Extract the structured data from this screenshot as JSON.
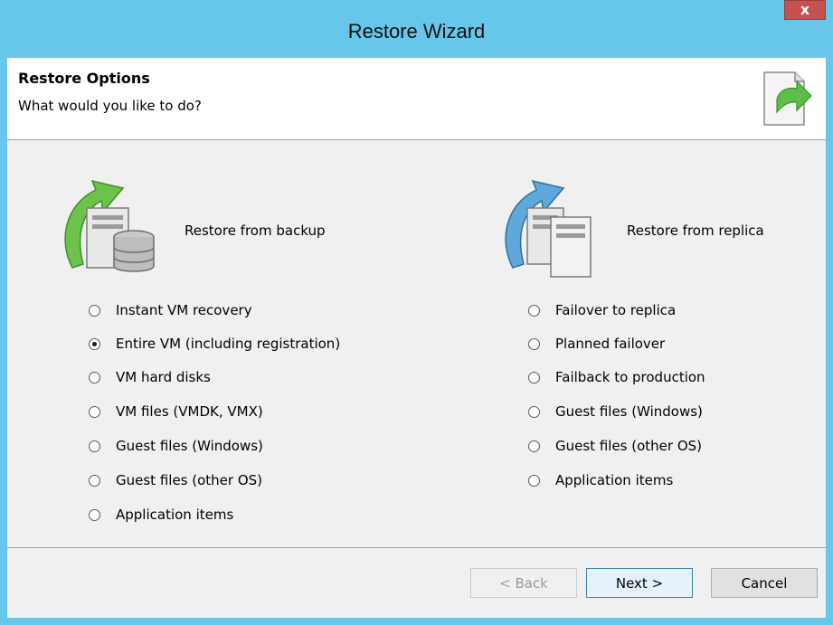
{
  "window": {
    "title": "Restore Wizard",
    "close_symbol": "x"
  },
  "header": {
    "title": "Restore Options",
    "subtitle": "What would you like to do?",
    "icon": "restore-wizard-icon"
  },
  "backup": {
    "label": "Restore from backup",
    "icon": "server-with-database-green-arrow-icon",
    "options": [
      {
        "label": "Instant VM recovery",
        "checked": false
      },
      {
        "label": "Entire VM (including registration)",
        "checked": true
      },
      {
        "label": "VM hard disks",
        "checked": false
      },
      {
        "label": "VM files (VMDK, VMX)",
        "checked": false
      },
      {
        "label": "Guest files (Windows)",
        "checked": false
      },
      {
        "label": "Guest files (other OS)",
        "checked": false
      },
      {
        "label": "Application items",
        "checked": false
      }
    ]
  },
  "replica": {
    "label": "Restore from replica",
    "icon": "two-servers-blue-arrow-icon",
    "options": [
      {
        "label": "Failover to replica",
        "checked": false
      },
      {
        "label": "Planned failover",
        "checked": false
      },
      {
        "label": "Failback to production",
        "checked": false
      },
      {
        "label": "Guest files (Windows)",
        "checked": false
      },
      {
        "label": "Guest files (other OS)",
        "checked": false
      },
      {
        "label": "Application items",
        "checked": false
      }
    ]
  },
  "buttons": {
    "back": "< Back",
    "next": "Next >",
    "cancel": "Cancel"
  },
  "colors": {
    "titlebar": "#66c7ea",
    "close": "#c75050",
    "body": "#f0f0f0"
  }
}
